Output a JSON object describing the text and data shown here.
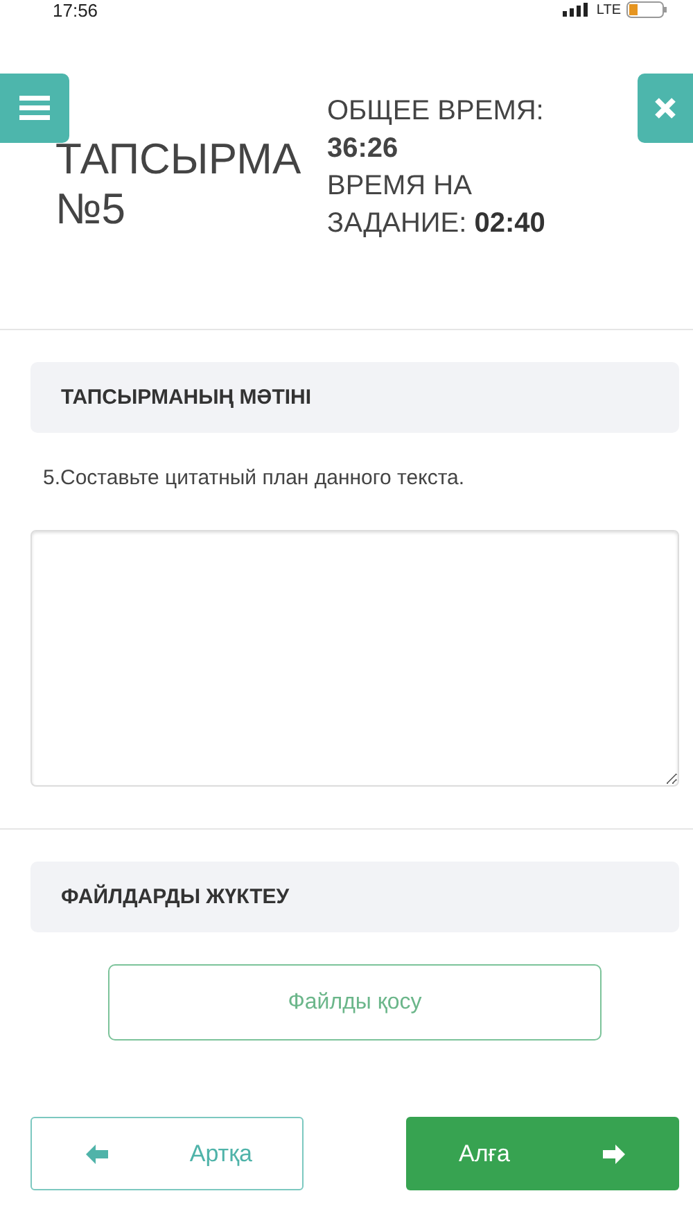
{
  "status_bar": {
    "time": "17:56",
    "network": "LTE"
  },
  "header": {
    "title": "ТАПСЫРМА №5",
    "total_time_label": "ОБЩЕЕ ВРЕМЯ:",
    "total_time": "36:26",
    "task_time_label": "ВРЕМЯ НА ЗАДАНИЕ:",
    "task_time": "02:40"
  },
  "task": {
    "heading": "ТАПСЫРМАНЫҢ МӘТІНІ",
    "text": "5.Составьте цитатный план данного текста."
  },
  "upload": {
    "heading": "ФАЙЛДАРДЫ ЖҮКТЕУ",
    "button": "Файлды қосу"
  },
  "nav": [
    {
      "label": "Артқа",
      "kind": "back"
    },
    {
      "label": "Алға",
      "kind": "next"
    }
  ]
}
